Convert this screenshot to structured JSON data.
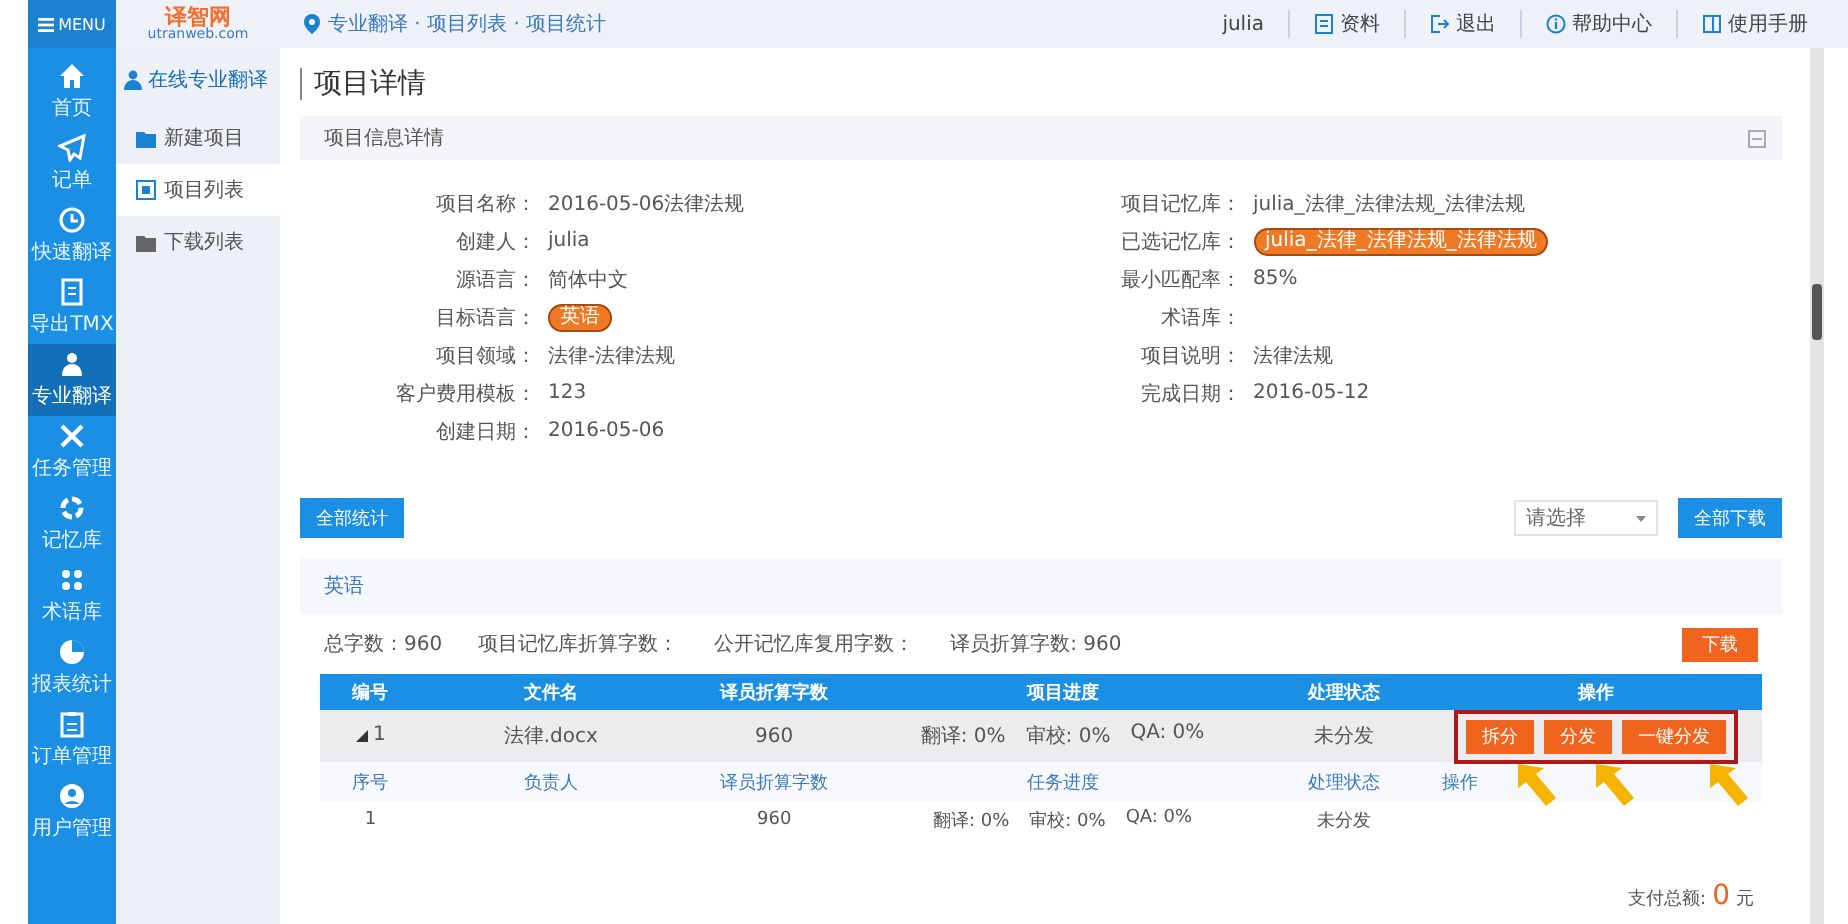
{
  "top_bar": {
    "menu_label": "MENU",
    "logo": {
      "name": "译智网",
      "domain": "utranweb.com"
    },
    "breadcrumb": "专业翻译 · 项目列表 · 项目统计",
    "user": "julia",
    "links": [
      "资料",
      "退出",
      "帮助中心",
      "使用手册"
    ]
  },
  "sidebar": {
    "items": [
      {
        "label": "首页",
        "selected": false
      },
      {
        "label": "记单",
        "selected": false
      },
      {
        "label": "快速翻译",
        "selected": false
      },
      {
        "label": "导出TMX",
        "selected": false
      },
      {
        "label": "专业翻译",
        "selected": true
      },
      {
        "label": "任务管理",
        "selected": false
      },
      {
        "label": "记忆库",
        "selected": false
      },
      {
        "label": "术语库",
        "selected": false
      },
      {
        "label": "报表统计",
        "selected": false
      },
      {
        "label": "订单管理",
        "selected": false
      },
      {
        "label": "用户管理",
        "selected": false
      }
    ]
  },
  "subnav": {
    "title": "在线专业翻译",
    "items": [
      {
        "label": "新建项目",
        "selected": false
      },
      {
        "label": "项目列表",
        "selected": true
      },
      {
        "label": "下载列表",
        "selected": false
      }
    ]
  },
  "page_title": "项目详情",
  "detail_panel": {
    "title": "项目信息详情",
    "left": [
      {
        "label": "项目名称：",
        "value": "2016-05-06法律法规",
        "kind": "text"
      },
      {
        "label": "创建人：",
        "value": "julia",
        "kind": "text"
      },
      {
        "label": "源语言：",
        "value": "简体中文",
        "kind": "text"
      },
      {
        "label": "目标语言：",
        "value": "英语",
        "kind": "tag"
      },
      {
        "label": "项目领域：",
        "value": "法律-法律法规",
        "kind": "text"
      },
      {
        "label": "客户费用模板：",
        "value": "123",
        "kind": "text"
      },
      {
        "label": "创建日期：",
        "value": "2016-05-06",
        "kind": "text"
      }
    ],
    "right": [
      {
        "label": "项目记忆库：",
        "value": "julia_法律_法律法规_法律法规",
        "kind": "text"
      },
      {
        "label": "已选记忆库：",
        "value": "julia_法律_法律法规_法律法规",
        "kind": "tag"
      },
      {
        "label": "最小匹配率：",
        "value": "85%",
        "kind": "text"
      },
      {
        "label": "术语库：",
        "kind": "text"
      },
      {
        "label": "项目说明：",
        "value": "法律法规",
        "kind": "text"
      },
      {
        "label": "完成日期：",
        "value": "2016-05-12",
        "kind": "text"
      }
    ]
  },
  "toolbar": {
    "stats_button": "全部统计",
    "select_placeholder": "请选择",
    "download_all_button": "全部下载"
  },
  "language_section": {
    "title": "英语",
    "stats": [
      "总字数：960",
      "项目记忆库折算字数：",
      "公开记忆库复用字数：",
      "译员折算字数: 960"
    ],
    "download_button": "下载",
    "columns": [
      "编号",
      "文件名",
      "译员折算字数",
      "项目进度",
      "处理状态",
      "操作"
    ],
    "rows": [
      {
        "expanded": true,
        "number": "1",
        "file": "法律.docx",
        "words": "960",
        "progress": [
          "翻译: 0%",
          "审校: 0%",
          "QA: 0%"
        ],
        "status": "未分发",
        "actions": [
          "拆分",
          "分发",
          "一键分发"
        ],
        "highlighted": true,
        "tasks": {
          "columns": [
            "序号",
            "负责人",
            "译员折算字数",
            "任务进度",
            "处理状态",
            "操作"
          ],
          "rows": [
            {
              "number": "1",
              "words": "960",
              "progress": [
                "翻译: 0%",
                "审校: 0%",
                "QA: 0%"
              ],
              "status": "未分发"
            }
          ]
        }
      }
    ],
    "payment": {
      "label": "支付总额:",
      "amount": "0",
      "unit": "元"
    }
  }
}
